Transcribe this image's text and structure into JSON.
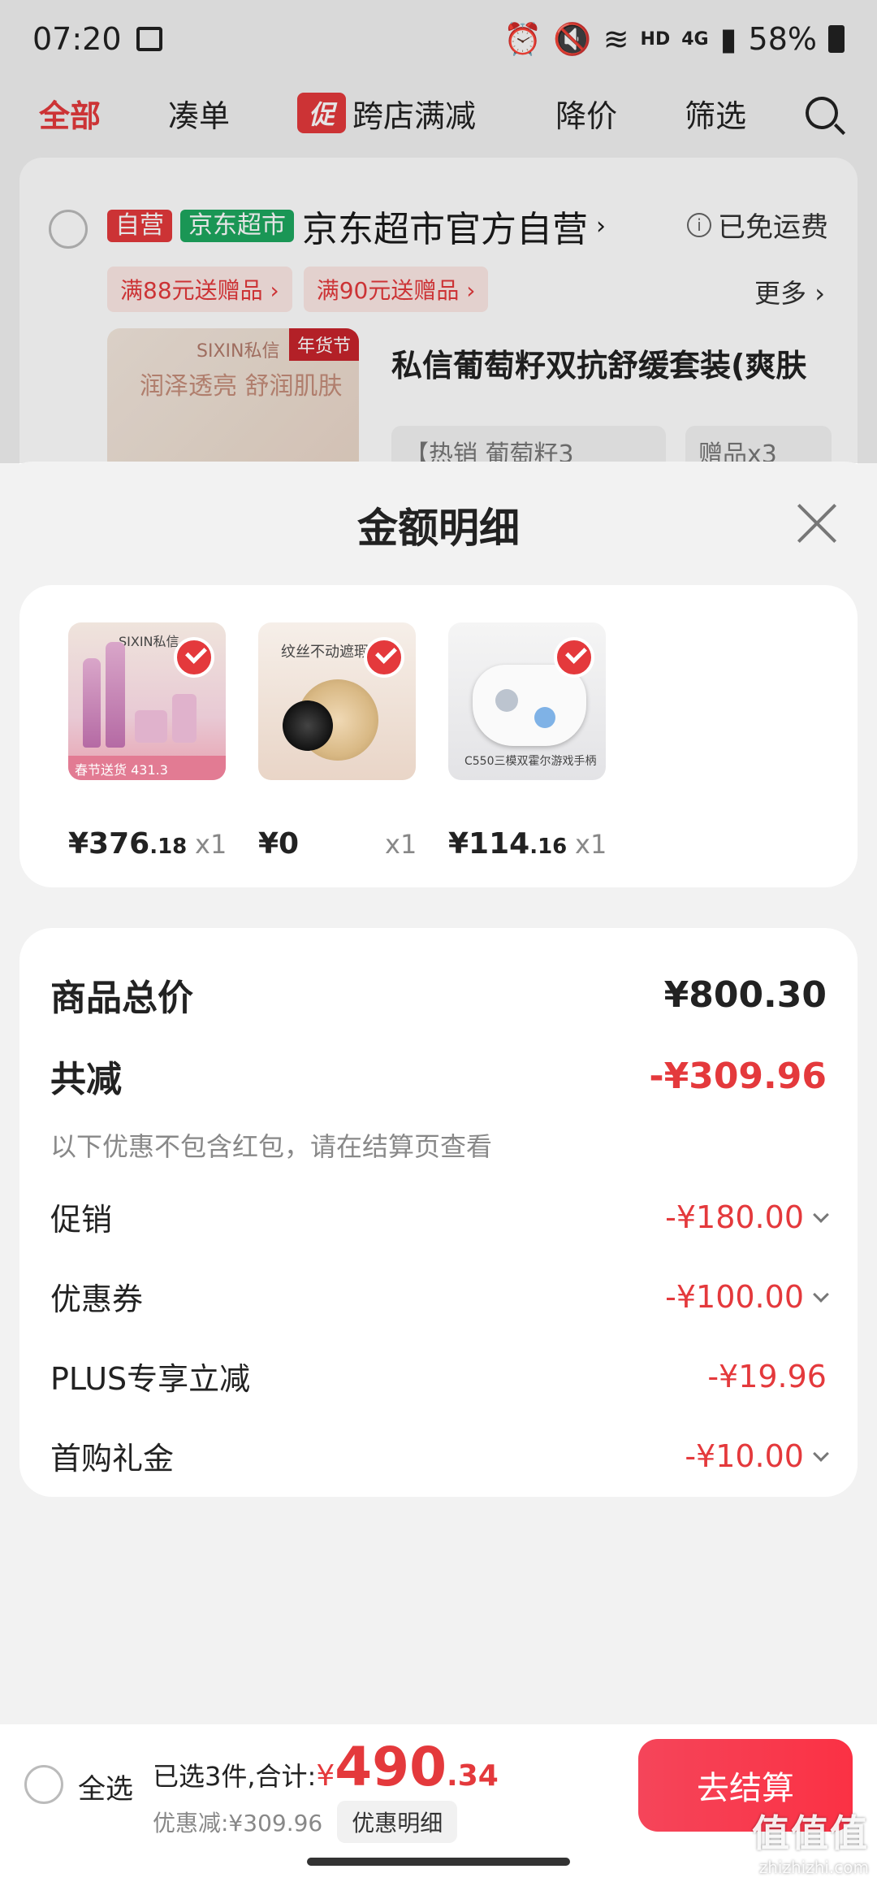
{
  "status_bar": {
    "time": "07:20",
    "hd": "HD",
    "network": "4G",
    "battery": "58%"
  },
  "tabs": {
    "all": "全部",
    "cou": "凑单",
    "promo_tag": "促",
    "cross_store": "跨店满减",
    "price_drop": "降价",
    "filter": "筛选"
  },
  "store": {
    "tag_self": "自营",
    "tag_market": "京东超市",
    "name": "京东超市官方自营",
    "chevron": "›",
    "free_shipping": "已免运费",
    "coupons": [
      "满88元送赠品 ›",
      "满90元送赠品 ›"
    ],
    "more": "更多 ›",
    "product_title": "私信葡萄籽双抗舒缓套装(爽肤",
    "sku1": "【热销 葡萄籽3",
    "sku2": "赠品x3",
    "thumb_brand": "SIXIN私信",
    "thumb_badge": "年货节",
    "thumb_slogan": "润泽透亮 舒润肌肤"
  },
  "sheet": {
    "title": "金额明细",
    "items": [
      {
        "int": "¥376",
        "dec": ".18",
        "qty": "x1",
        "caption": "SIXIN私信",
        "footer": "春节送货 431.3"
      },
      {
        "int": "¥0",
        "dec": "",
        "qty": "x1",
        "caption": "纹丝不动遮瑕膏"
      },
      {
        "int": "¥114",
        "dec": ".16",
        "qty": "x1",
        "caption": "C550三模双霍尔游戏手柄"
      }
    ],
    "summary": {
      "goods_total_label": "商品总价",
      "goods_total_value": "¥800.30",
      "reduce_label": "共减",
      "reduce_value": "-¥309.96",
      "note": "以下优惠不包含红包，请在结算页查看",
      "promo_label": "促销",
      "promo_value": "-¥180.00",
      "coupon_label": "优惠券",
      "coupon_value": "-¥100.00",
      "plus_label": "PLUS专享立减",
      "plus_value": "-¥19.96",
      "first_label": "首购礼金",
      "first_value": "-¥10.00"
    }
  },
  "bottom": {
    "select_all": "全选",
    "selected_text": "已选3件,合计:",
    "currency": "¥",
    "total_int": "490",
    "total_dec": ".34",
    "discount_text": "优惠减:¥309.96",
    "detail_button": "优惠明细",
    "checkout": "去结算"
  },
  "watermark": {
    "line1": "值值值",
    "line2": "zhizhizhi.com"
  },
  "colors": {
    "accent": "#e4393c",
    "green_tag": "#1ea75f",
    "checkout": "#f5455a"
  }
}
